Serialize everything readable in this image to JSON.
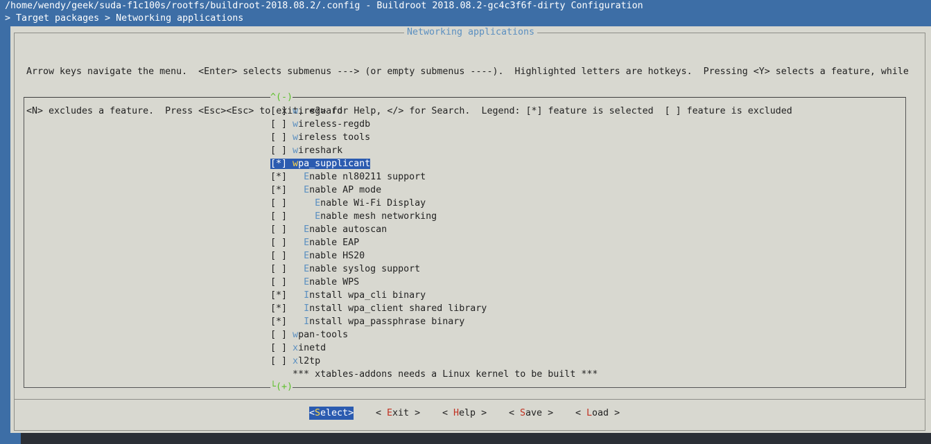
{
  "window": {
    "title": "/home/wendy/geek/suda-f1c100s/rootfs/buildroot-2018.08.2/.config - Buildroot 2018.08.2-gc4c3f6f-dirty Configuration",
    "breadcrumb": "> Target packages > Networking applications"
  },
  "dialog": {
    "title": "Networking applications",
    "help_line1": "Arrow keys navigate the menu.  <Enter> selects submenus ---> (or empty submenus ----).  Highlighted letters are hotkeys.  Pressing <Y> selects a feature, while",
    "help_line2": "<N> excludes a feature.  Press <Esc><Esc> to exit, <?> for Help, </> for Search.  Legend: [*] feature is selected  [ ] feature is excluded",
    "scroll_up": "^(-)",
    "scroll_down": "└(+)"
  },
  "menu": {
    "items": [
      {
        "check": "[ ]",
        "indent": " ",
        "hotkey": "w",
        "rest": "ireguard"
      },
      {
        "check": "[ ]",
        "indent": " ",
        "hotkey": "w",
        "rest": "ireless-regdb"
      },
      {
        "check": "[ ]",
        "indent": " ",
        "hotkey": "w",
        "rest": "ireless tools"
      },
      {
        "check": "[ ]",
        "indent": " ",
        "hotkey": "w",
        "rest": "ireshark"
      },
      {
        "check": "[*]",
        "indent": " ",
        "hotkey": "w",
        "rest": "pa_supplicant",
        "selected": true
      },
      {
        "check": "[*]",
        "indent": "   ",
        "hotkey": "E",
        "rest": "nable nl80211 support"
      },
      {
        "check": "[*]",
        "indent": "   ",
        "hotkey": "E",
        "rest": "nable AP mode"
      },
      {
        "check": "[ ]",
        "indent": "     ",
        "hotkey": "E",
        "rest": "nable Wi-Fi Display"
      },
      {
        "check": "[ ]",
        "indent": "     ",
        "hotkey": "E",
        "rest": "nable mesh networking"
      },
      {
        "check": "[ ]",
        "indent": "   ",
        "hotkey": "E",
        "rest": "nable autoscan"
      },
      {
        "check": "[ ]",
        "indent": "   ",
        "hotkey": "E",
        "rest": "nable EAP"
      },
      {
        "check": "[ ]",
        "indent": "   ",
        "hotkey": "E",
        "rest": "nable HS20"
      },
      {
        "check": "[ ]",
        "indent": "   ",
        "hotkey": "E",
        "rest": "nable syslog support"
      },
      {
        "check": "[ ]",
        "indent": "   ",
        "hotkey": "E",
        "rest": "nable WPS"
      },
      {
        "check": "[*]",
        "indent": "   ",
        "hotkey": "I",
        "rest": "nstall wpa_cli binary"
      },
      {
        "check": "[*]",
        "indent": "   ",
        "hotkey": "I",
        "rest": "nstall wpa_client shared library"
      },
      {
        "check": "[*]",
        "indent": "   ",
        "hotkey": "I",
        "rest": "nstall wpa_passphrase binary"
      },
      {
        "check": "[ ]",
        "indent": " ",
        "hotkey": "w",
        "rest": "pan-tools"
      },
      {
        "check": "[ ]",
        "indent": " ",
        "hotkey": "x",
        "rest": "inetd"
      },
      {
        "check": "[ ]",
        "indent": " ",
        "hotkey": "x",
        "rest": "l2tp"
      },
      {
        "check": "   ",
        "indent": " ",
        "hotkey": "",
        "rest": "*** xtables-addons needs a Linux kernel to be built ***"
      }
    ]
  },
  "buttons": [
    {
      "pre": "<",
      "hotkey": "S",
      "rest": "elect",
      "post": ">",
      "active": true
    },
    {
      "pre": "< ",
      "hotkey": "E",
      "rest": "xit",
      "post": " >"
    },
    {
      "pre": "< ",
      "hotkey": "H",
      "rest": "elp",
      "post": " >"
    },
    {
      "pre": "< ",
      "hotkey": "S",
      "rest": "ave",
      "post": " >"
    },
    {
      "pre": "< ",
      "hotkey": "L",
      "rest": "oad",
      "post": " >"
    }
  ],
  "colors": {
    "background": "#3d6ea6",
    "dialog": "#d8d8d0",
    "highlight": "#2b5bb0",
    "hotkey": "#5b8fc0",
    "button_hotkey": "#c03020",
    "scroll_indicator": "#5cbf2a"
  }
}
